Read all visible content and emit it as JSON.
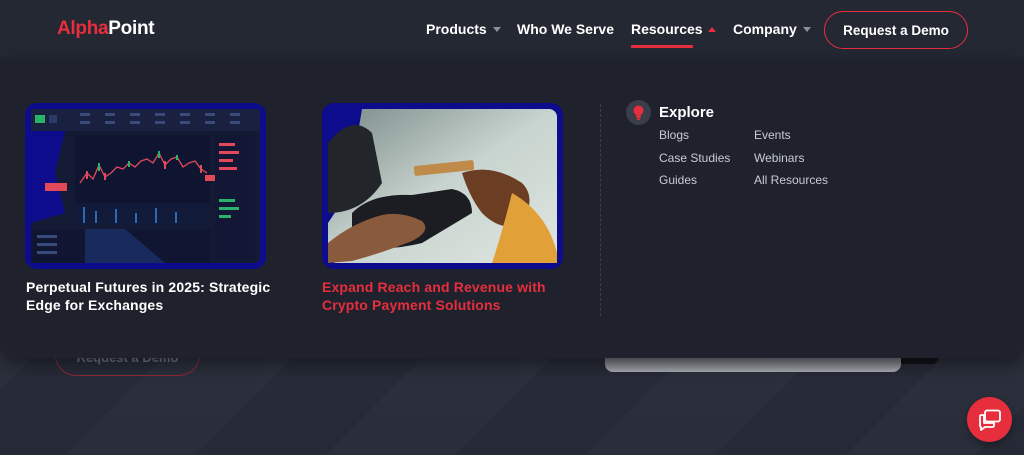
{
  "header": {
    "logo_part1": "Alpha",
    "logo_part2": "Point",
    "nav": [
      {
        "label": "Products"
      },
      {
        "label": "Who We Serve"
      },
      {
        "label": "Resources"
      },
      {
        "label": "Company"
      }
    ],
    "demo_label": "Request a Demo"
  },
  "menu": {
    "cards": [
      {
        "title": "Perpetual Futures in 2025: Strategic Edge for Exchanges"
      },
      {
        "title": "Expand Reach and Revenue with Crypto Payment Solutions"
      }
    ],
    "explore": {
      "title": "Explore",
      "links_col1": [
        "Blogs",
        "Case Studies",
        "Guides"
      ],
      "links_col2": [
        "Events",
        "Webinars",
        "All Resources"
      ]
    }
  },
  "background": {
    "demo_label": "Request a Demo"
  },
  "colors": {
    "accent": "#e62e3d",
    "panel": "#1f222d",
    "header": "#242833",
    "thumb_border": "#0c0c8c"
  },
  "icons": {
    "explore": "lightbulb-icon",
    "chat": "chat-bubbles-icon"
  }
}
